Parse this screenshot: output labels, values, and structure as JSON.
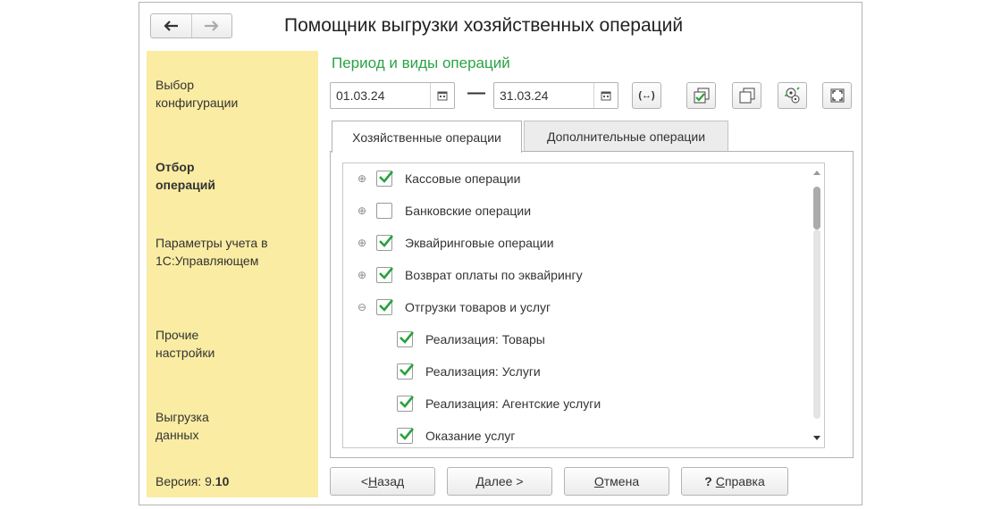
{
  "window": {
    "title": "Помощник выгрузки хозяйственных операций",
    "nav": {
      "back_icon": "arrow-left-icon",
      "forward_icon": "arrow-right-icon"
    }
  },
  "sidebar": {
    "items": [
      {
        "label": "Выбор конфигурации",
        "active": false
      },
      {
        "label": "Отбор операций",
        "active": true
      },
      {
        "label": "Параметры учета в 1С:Управляющем",
        "active": false
      },
      {
        "label": "Прочие настройки",
        "active": false
      },
      {
        "label": "Выгрузка данных",
        "active": false
      }
    ],
    "version_label": "Версия: 9.",
    "version_bold": "10"
  },
  "main": {
    "section_title": "Период и виды операций",
    "period": {
      "start": "01.03.24",
      "end": "31.03.24",
      "separator": "—"
    },
    "toolbar_icons": [
      "period-select-icon",
      "check-all-icon",
      "uncheck-all-icon",
      "settings-icon",
      "fullscreen-icon"
    ],
    "tabs": [
      {
        "label": "Хозяйственные операции",
        "active": true
      },
      {
        "label": "Дополнительные операции",
        "active": false
      }
    ],
    "tree": [
      {
        "label": "Кассовые операции",
        "checked": true,
        "expander": "plus",
        "level": 0
      },
      {
        "label": "Банковские операции",
        "checked": false,
        "expander": "plus",
        "level": 0
      },
      {
        "label": "Эквайринговые операции",
        "checked": true,
        "expander": "plus",
        "level": 0
      },
      {
        "label": "Возврат оплаты по эквайрингу",
        "checked": true,
        "expander": "plus",
        "level": 0
      },
      {
        "label": "Отгрузки товаров и услуг",
        "checked": true,
        "expander": "minus",
        "level": 0
      },
      {
        "label": "Реализация: Товары",
        "checked": true,
        "expander": "none",
        "level": 1
      },
      {
        "label": "Реализация: Услуги",
        "checked": true,
        "expander": "none",
        "level": 1
      },
      {
        "label": "Реализация: Агентские услуги",
        "checked": true,
        "expander": "none",
        "level": 1
      },
      {
        "label": "Оказание услуг",
        "checked": true,
        "expander": "none",
        "level": 1
      }
    ]
  },
  "footer": {
    "back": {
      "prefix": "< ",
      "underlined": "Н",
      "rest": "азад"
    },
    "next": {
      "underlined": "Д",
      "rest": "алее >"
    },
    "cancel": {
      "underlined": "О",
      "rest": "тмена"
    },
    "help": {
      "prefix": "? ",
      "underlined": "С",
      "rest": "правка"
    }
  },
  "colors": {
    "accent_green": "#2aa345",
    "sidebar_bg": "#faeca2",
    "check_green": "#25a33b"
  }
}
